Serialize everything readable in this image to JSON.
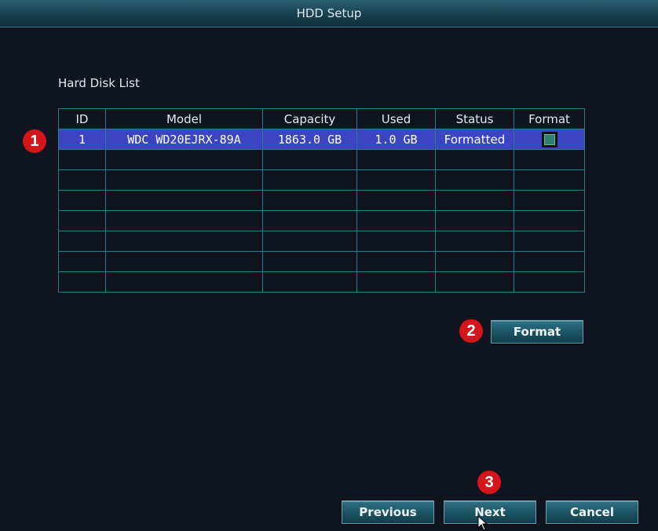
{
  "window": {
    "title": "HDD Setup"
  },
  "section_label": "Hard Disk List",
  "table": {
    "headers": [
      "ID",
      "Model",
      "Capacity",
      "Used",
      "Status",
      "Format"
    ],
    "rows": [
      {
        "id": "1",
        "model": "WDC WD20EJRX-89A",
        "capacity": "1863.0 GB",
        "used": "1.0 GB",
        "status": "Formatted",
        "format_checked": true
      }
    ]
  },
  "buttons": {
    "format": "Format",
    "previous": "Previous",
    "next": "Next",
    "cancel": "Cancel"
  },
  "badges": [
    "1",
    "2",
    "3"
  ],
  "colors": {
    "selected_row": "#3b45c2",
    "badge": "#d4151b",
    "grid": "#2b7a8a"
  }
}
